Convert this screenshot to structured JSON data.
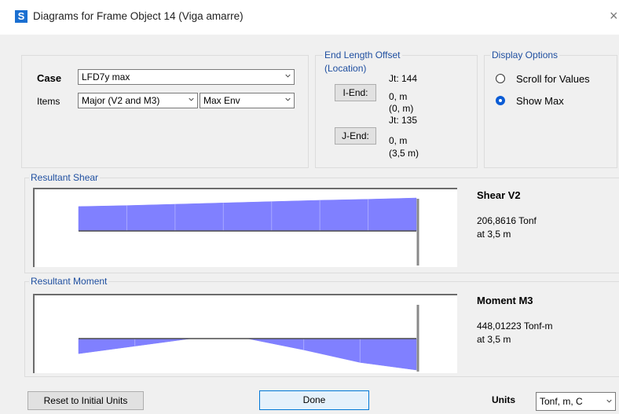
{
  "window": {
    "title": "Diagrams for Frame Object 14  (Viga amarre)",
    "app_icon_letter": "S",
    "close_glyph": "×"
  },
  "case": {
    "label": "Case",
    "value": "LFD7y max"
  },
  "items": {
    "label": "Items",
    "component": "Major (V2 and M3)",
    "envelope": "Max Env"
  },
  "end_length_offset": {
    "title_line1": "End Length Offset",
    "title_line2": "(Location)",
    "i_end": {
      "button": "I-End:",
      "jt": "Jt:  144",
      "offset": "0, m",
      "location": "(0, m)"
    },
    "j_end": {
      "button": "J-End:",
      "jt": "Jt:  135",
      "offset": "0, m",
      "location": "(3,5 m)"
    }
  },
  "display_options": {
    "title": "Display Options",
    "options": [
      {
        "label": "Scroll for Values",
        "selected": false
      },
      {
        "label": "Show Max",
        "selected": true
      }
    ]
  },
  "shear": {
    "group_title": "Resultant Shear",
    "heading": "Shear V2",
    "value": "206,8616 Tonf",
    "location": "at 3,5 m",
    "fill_color": "#8080ff",
    "values_relative": [
      0.74,
      0.77,
      0.81,
      0.85,
      0.89,
      0.93,
      0.96,
      1.0
    ]
  },
  "moment": {
    "group_title": "Resultant Moment",
    "heading": "Moment M3",
    "value": "448,01223 Tonf-m",
    "location": "at 3,5 m",
    "fill_color": "#8080ff",
    "values_relative": [
      0.48,
      0.24,
      0.0,
      0.0,
      0.36,
      0.76,
      1.0
    ]
  },
  "footer": {
    "reset_button": "Reset to Initial Units",
    "done_button": "Done",
    "units_label": "Units",
    "units_value": "Tonf, m, C"
  },
  "colors": {
    "legend": "#1f4fa0",
    "diagram_fill": "#8080ff",
    "diagram_line": "#a8a8ff"
  }
}
